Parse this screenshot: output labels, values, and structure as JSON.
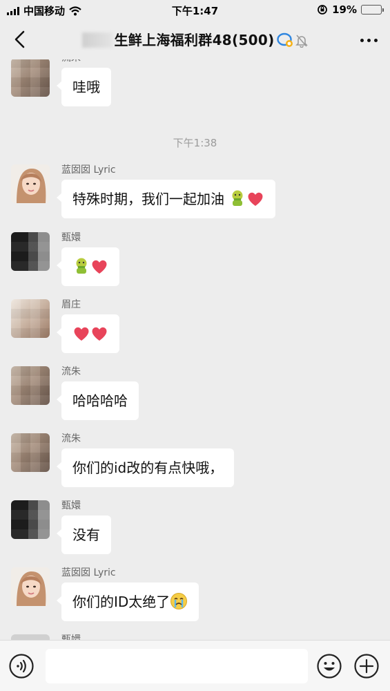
{
  "status_bar": {
    "carrier": "中国移动",
    "time": "下午1:47",
    "battery": "19%",
    "battery_level": 0.19
  },
  "nav": {
    "title_visible": "生鲜上海福利群",
    "group_number": "48",
    "member_count": "(500)"
  },
  "messages": {
    "time_separator": "下午1:38",
    "items": [
      {
        "sender": "流朱",
        "text": "哇哦",
        "avatar": "blurred-face"
      },
      {
        "sender": "蓝囡囡 Lyric",
        "text": "特殊时期，我们一起加油",
        "emoji": [
          "puke-emoji",
          "heart-emoji"
        ],
        "avatar": "girl-portrait"
      },
      {
        "sender": "甄嬛",
        "text": "",
        "emoji": [
          "puke-emoji",
          "heart-emoji"
        ],
        "avatar": "dark-blurred"
      },
      {
        "sender": "眉庄",
        "text": "",
        "emoji": [
          "heart-emoji",
          "heart-emoji"
        ],
        "avatar": "light-blurred"
      },
      {
        "sender": "流朱",
        "text": "哈哈哈哈",
        "avatar": "blurred-face"
      },
      {
        "sender": "流朱",
        "text": "你们的id改的有点快哦，",
        "avatar": "blurred-face"
      },
      {
        "sender": "甄嬛",
        "text": "没有",
        "avatar": "dark-blurred"
      },
      {
        "sender": "蓝囡囡 Lyric",
        "text": "你们的ID太绝了",
        "emoji": [
          "crying-emoji"
        ],
        "avatar": "girl-portrait"
      },
      {
        "sender": "甄嬛",
        "text": "",
        "avatar": "gray"
      }
    ]
  },
  "input_bar": {
    "voice_icon": "voice-icon",
    "emoji_icon": "smiley-icon",
    "plus_icon": "plus-icon"
  },
  "colors": {
    "background": "#ededed",
    "bubble": "#ffffff",
    "heart": "#e8445a"
  }
}
